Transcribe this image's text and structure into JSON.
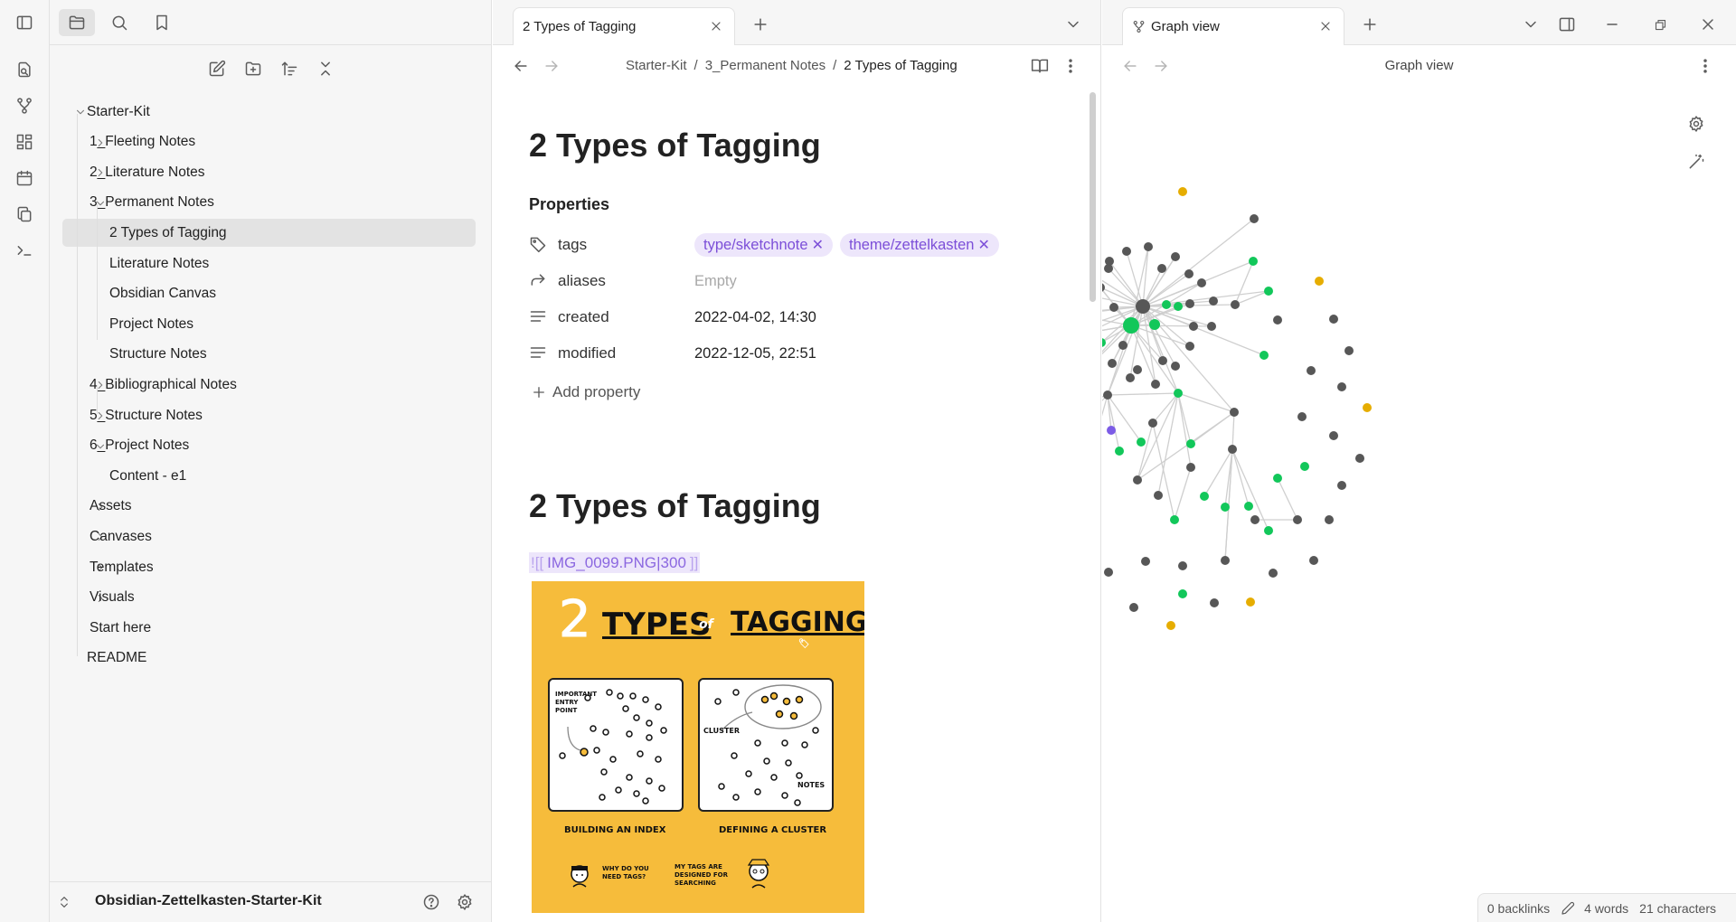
{
  "ribbon": {
    "icons": [
      "open-quick-switcher-icon",
      "graph-icon",
      "canvas-icon",
      "daily-notes-icon",
      "templates-icon",
      "command-palette-icon"
    ]
  },
  "sidebar": {
    "tree": [
      {
        "label": "Starter-Kit",
        "level": 0,
        "expanded": true
      },
      {
        "label": "1_Fleeting Notes",
        "level": 1,
        "expanded": false
      },
      {
        "label": "2_Literature Notes",
        "level": 1,
        "expanded": false
      },
      {
        "label": "3_Permanent Notes",
        "level": 1,
        "expanded": true
      },
      {
        "label": "2 Types of Tagging",
        "level": 2,
        "file": true,
        "selected": true
      },
      {
        "label": "Literature Notes",
        "level": 2,
        "file": true
      },
      {
        "label": "Obsidian Canvas",
        "level": 2,
        "file": true
      },
      {
        "label": "Project Notes",
        "level": 2,
        "file": true
      },
      {
        "label": "Structure Notes",
        "level": 2,
        "file": true
      },
      {
        "label": "4_Bibliographical Notes",
        "level": 1,
        "expanded": false
      },
      {
        "label": "5_Structure Notes",
        "level": 1,
        "expanded": false
      },
      {
        "label": "6_Project Notes",
        "level": 1,
        "expanded": true
      },
      {
        "label": "Content - e1",
        "level": 2,
        "file": true
      },
      {
        "label": "Assets",
        "level": 1,
        "expanded": false
      },
      {
        "label": "Canvases",
        "level": 1,
        "expanded": false
      },
      {
        "label": "Templates",
        "level": 1,
        "expanded": false
      },
      {
        "label": "Visuals",
        "level": 1,
        "expanded": false
      },
      {
        "label": "Start here",
        "level": 1,
        "file": true
      },
      {
        "label": "README",
        "level": 0,
        "file": true
      }
    ],
    "vault_name": "Obsidian-Zettelkasten-Starter-Kit"
  },
  "editor": {
    "tab_title": "2 Types of Tagging",
    "breadcrumb": [
      "Starter-Kit",
      "3_Permanent Notes",
      "2 Types of Tagging"
    ],
    "breadcrumb_sep": "/",
    "note_title": "2 Types of Tagging",
    "properties_heading": "Properties",
    "properties": {
      "tags_key": "tags",
      "tags": [
        "type/sketchnote",
        "theme/zettelkasten"
      ],
      "aliases_key": "aliases",
      "aliases_value": "Empty",
      "created_key": "created",
      "created_value": "2022-04-02, 14:30",
      "modified_key": "modified",
      "modified_value": "2022-12-05, 22:51"
    },
    "add_property": "Add property",
    "heading2": "2 Types of Tagging",
    "embed_prefix": "![[",
    "embed_target": "IMG_0099.PNG|300",
    "embed_suffix": "]]",
    "sketch": {
      "title_num": "2",
      "title_word1": "TYPES",
      "title_of": "of",
      "title_word2": "TAGGING",
      "left_note": "IMPORTANT ENTRY POINT",
      "right_note": "CLUSTER",
      "notes_label": "NOTES",
      "caption_left": "BUILDING AN INDEX",
      "caption_right": "DEFINING A CLUSTER",
      "bubble_left": "WHY DO YOU NEED TAGS?",
      "bubble_right": "MY TAGS ARE DESIGNED FOR SEARCHING"
    }
  },
  "graph": {
    "tab_title": "Graph view",
    "header_title": "Graph view",
    "colors": {
      "default": "#575757",
      "green": "#12c75a",
      "yellow": "#e6ad00",
      "purple": "#7c5ce6",
      "edge": "#cfcfcf"
    }
  },
  "status": {
    "backlinks": "0 backlinks",
    "words": "4 words",
    "characters": "21 characters"
  }
}
